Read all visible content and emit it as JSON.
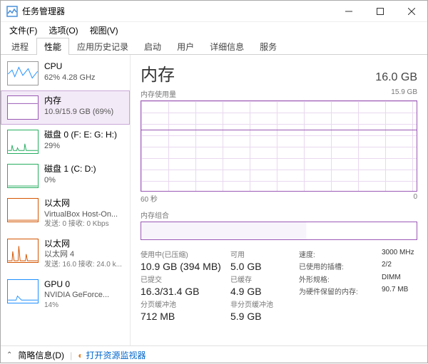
{
  "window": {
    "title": "任务管理器"
  },
  "menu": {
    "file": "文件(F)",
    "options": "选项(O)",
    "view": "视图(V)"
  },
  "tabs": [
    {
      "label": "进程"
    },
    {
      "label": "性能"
    },
    {
      "label": "应用历史记录"
    },
    {
      "label": "启动"
    },
    {
      "label": "用户"
    },
    {
      "label": "详细信息"
    },
    {
      "label": "服务"
    }
  ],
  "sidebar": [
    {
      "title": "CPU",
      "sub": "62%  4.28 GHz",
      "sub2": ""
    },
    {
      "title": "内存",
      "sub": "10.9/15.9 GB (69%)",
      "sub2": ""
    },
    {
      "title": "磁盘 0 (F: E: G: H:)",
      "sub": "29%",
      "sub2": ""
    },
    {
      "title": "磁盘 1 (C: D:)",
      "sub": "0%",
      "sub2": ""
    },
    {
      "title": "以太网",
      "sub": "VirtualBox Host-On...",
      "sub2": "发送: 0  接收: 0 Kbps"
    },
    {
      "title": "以太网",
      "sub": "以太网 4",
      "sub2": "发送: 16.0  接收: 24.0 k..."
    },
    {
      "title": "GPU 0",
      "sub": "NVIDIA GeForce...",
      "sub2": "14%"
    }
  ],
  "main": {
    "title": "内存",
    "total": "16.0 GB",
    "usage_caption": "内存使用量",
    "usage_max": "15.9 GB",
    "xaxis_left": "60 秒",
    "xaxis_right": "0",
    "composition_caption": "内存组合",
    "stats": {
      "in_use_label": "使用中(已压缩)",
      "in_use_value": "10.9 GB (394 MB)",
      "available_label": "可用",
      "available_value": "5.0 GB",
      "committed_label": "已提交",
      "committed_value": "16.3/31.4 GB",
      "cached_label": "已缓存",
      "cached_value": "4.9 GB",
      "paged_label": "分页缓冲池",
      "paged_value": "712 MB",
      "nonpaged_label": "非分页缓冲池",
      "nonpaged_value": "5.9 GB"
    },
    "right_stats": {
      "speed_label": "速度:",
      "speed_value": "3000 MHz",
      "slots_label": "已使用的插槽:",
      "slots_value": "2/2",
      "form_label": "外形规格:",
      "form_value": "DIMM",
      "hw_reserved_label": "为硬件保留的内存:",
      "hw_reserved_value": "90.7 MB"
    }
  },
  "footer": {
    "fewer_details": "简略信息(D)",
    "open_resmon": "打开资源监视器"
  },
  "chart_data": {
    "type": "line",
    "title": "内存使用量",
    "xlabel": "秒",
    "ylabel": "GB",
    "ylim": [
      0,
      15.9
    ],
    "x": [
      60,
      55,
      50,
      45,
      40,
      35,
      30,
      25,
      20,
      15,
      10,
      5,
      0
    ],
    "series": [
      {
        "name": "内存使用量",
        "values": [
          10.9,
          10.9,
          10.9,
          10.9,
          10.9,
          10.9,
          10.9,
          10.9,
          10.9,
          10.9,
          10.9,
          10.9,
          10.9
        ]
      }
    ]
  }
}
